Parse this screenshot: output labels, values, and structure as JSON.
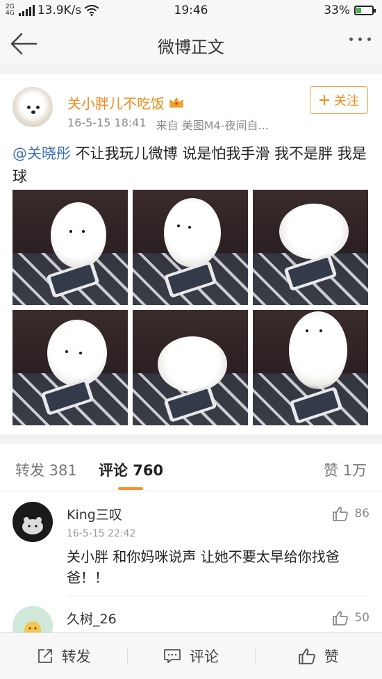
{
  "status_bar": {
    "network_top": "2G",
    "network_bottom": "4G",
    "speed": "13.9K/s",
    "time": "19:46",
    "battery": "33%",
    "battery_level": 0.33
  },
  "nav": {
    "title": "微博正文"
  },
  "post": {
    "author": "关小胖儿不吃饭",
    "date": "16-5-15 18:41",
    "source": "来自 美图M4-夜间自...",
    "follow_label": "关注",
    "mention": "@关晓彤",
    "text": " 不让我玩儿微博 说是怕我手滑 我不是胖 我是球",
    "photos": [
      "dog-photo-1",
      "dog-photo-2",
      "dog-photo-3",
      "dog-photo-4",
      "dog-photo-5",
      "dog-photo-6"
    ]
  },
  "tabs": {
    "repost": "转发 381",
    "comments": "评论 760",
    "likes": "赞 1万"
  },
  "comments": [
    {
      "name": "King三叹",
      "time": "16-5-15 22:42",
      "text": "关小胖 和你妈咪说声 让她不要太早给你找爸爸！！",
      "likes": "86"
    },
    {
      "name": "久树_26",
      "likes": "50"
    }
  ],
  "toolbar": {
    "repost": "转发",
    "comment": "评论",
    "like": "赞"
  },
  "colors": {
    "accent": "#f28c1d",
    "mention": "#3b6fb6"
  }
}
